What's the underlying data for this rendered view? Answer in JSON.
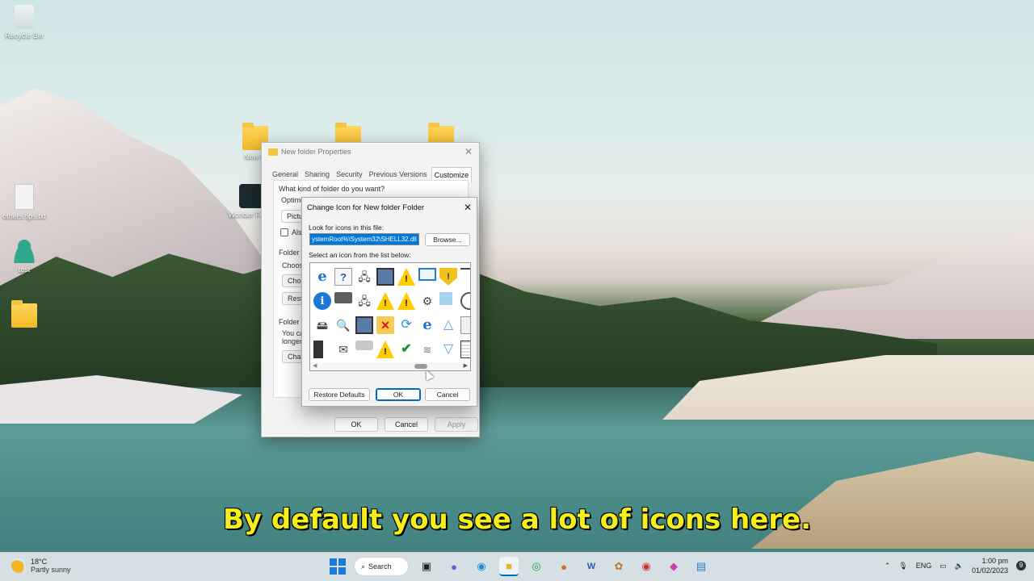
{
  "desktop": {
    "icons": [
      {
        "label": "Recycle Bin"
      },
      {
        "label": "New fo"
      },
      {
        "label": "others tips.txt"
      },
      {
        "label": "Wonder Filmor"
      },
      {
        "label": "test"
      }
    ]
  },
  "properties": {
    "title": "New folder Properties",
    "tabs": [
      "General",
      "Sharing",
      "Security",
      "Previous Versions",
      "Customize"
    ],
    "active_tab": "Customize",
    "q_kind": "What kind of folder do you want?",
    "optimize_label": "Optimize this folder for:",
    "optimize_value": "Picture",
    "also_apply_label": "Also",
    "folder_pictures_label": "Folder pi",
    "choose_text": "Choose",
    "choose_button": "Cho",
    "restore_button": "Resto",
    "folder_icons_label": "Folder ic",
    "folder_icons_text1": "You can",
    "folder_icons_text2": "longer s",
    "change_icon_button": "Chan",
    "ok": "OK",
    "cancel": "Cancel",
    "apply": "Apply"
  },
  "change_icon": {
    "title": "Change Icon for New folder Folder",
    "look_label": "Look for icons in this file:",
    "path_value": "ystemRoot%\\System32\\SHELL32.dll",
    "browse": "Browse...",
    "select_label": "Select an icon from the list below:",
    "icons": [
      "internet-explorer-icon",
      "help-document-icon",
      "network-computers-icon",
      "computer-network-icon",
      "warning-icon",
      "monitor-icon",
      "security-shield-icon",
      "lines-icon",
      "info-icon",
      "printer-icon",
      "network-computers-icon",
      "warning-icon",
      "warning-icon",
      "network-devices-icon",
      "blue-square-icon",
      "clock-icon",
      "network-drive-icon",
      "network-search-icon",
      "computer-network-icon",
      "folder-delete-icon",
      "refresh-icon",
      "internet-explorer-icon",
      "triangle-up-icon",
      "pages-icon",
      "server-check-icon",
      "mail-computer-icon",
      "scanner-icon",
      "warning-icon",
      "checkmark-icon",
      "wireless-drive-icon",
      "triangle-down-icon",
      "window-list-icon"
    ],
    "restore_defaults": "Restore Defaults",
    "ok": "OK",
    "cancel": "Cancel"
  },
  "caption": "By default you see a lot of icons here.",
  "taskbar": {
    "weather_temp": "18°C",
    "weather_desc": "Partly sunny",
    "search_label": "Search",
    "language": "ENG",
    "time": "1:00 pm",
    "date": "01/02/2023",
    "notification_count": "9"
  }
}
